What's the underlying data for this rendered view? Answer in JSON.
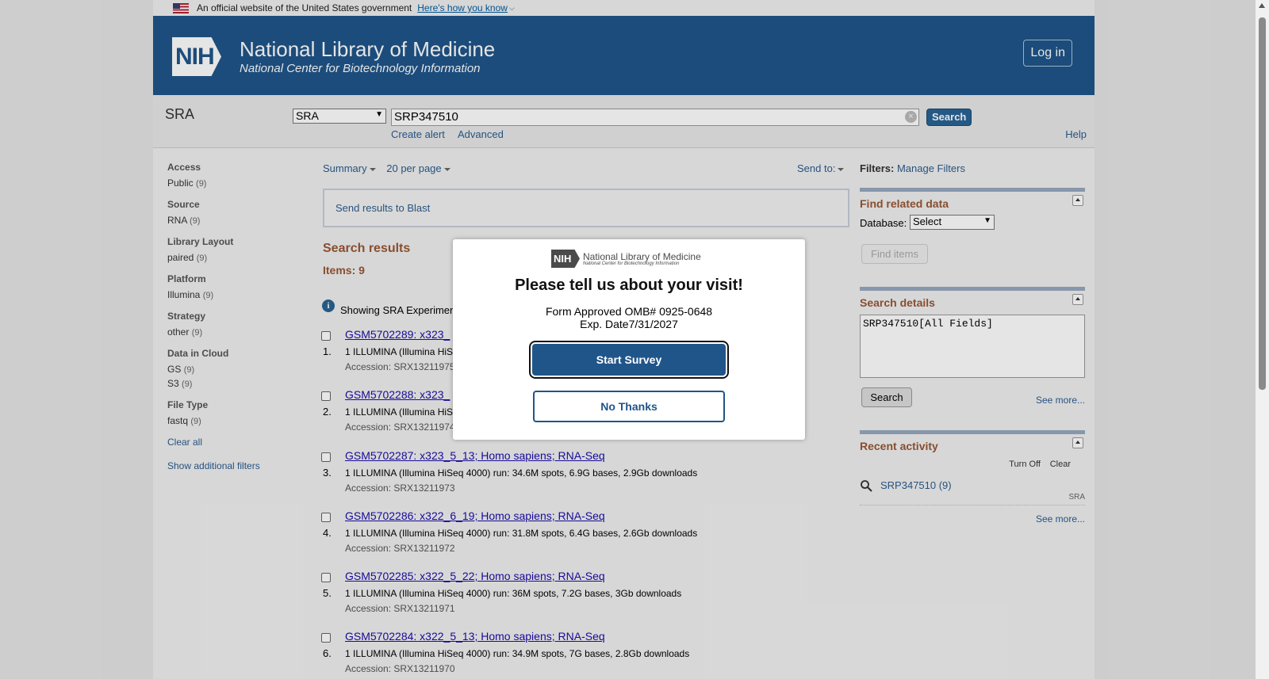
{
  "gov_banner": {
    "text": "An official website of the United States government",
    "link": "Here's how you know"
  },
  "header": {
    "logo_text": "NIH",
    "title": "National Library of Medicine",
    "subtitle": "National Center for Biotechnology Information",
    "login": "Log in"
  },
  "search": {
    "db_name": "SRA",
    "db_select": "SRA",
    "query": "SRP347510",
    "button": "Search",
    "create_alert": "Create alert",
    "advanced": "Advanced",
    "help": "Help"
  },
  "filters": {
    "groups": [
      {
        "title": "Access",
        "items": [
          {
            "label": "Public",
            "count": "(9)"
          }
        ]
      },
      {
        "title": "Source",
        "items": [
          {
            "label": "RNA",
            "count": "(9)"
          }
        ]
      },
      {
        "title": "Library Layout",
        "items": [
          {
            "label": "paired",
            "count": "(9)"
          }
        ]
      },
      {
        "title": "Platform",
        "items": [
          {
            "label": "Illumina",
            "count": "(9)"
          }
        ]
      },
      {
        "title": "Strategy",
        "items": [
          {
            "label": "other",
            "count": "(9)"
          }
        ]
      },
      {
        "title": "Data in Cloud",
        "items": [
          {
            "label": "GS",
            "count": "(9)"
          },
          {
            "label": "S3",
            "count": "(9)"
          }
        ]
      },
      {
        "title": "File Type",
        "items": [
          {
            "label": "fastq",
            "count": "(9)"
          }
        ]
      }
    ],
    "clear_all": "Clear all",
    "show_additional": "Show additional filters"
  },
  "toolbar": {
    "summary": "Summary",
    "per_page": "20 per page",
    "send_to": "Send to:"
  },
  "blast_link": "Send results to Blast",
  "results": {
    "title": "Search results",
    "items": "Items: 9",
    "showing": "Showing SRA Experimen",
    "rows": [
      {
        "num": "1.",
        "title": "GSM5702289: x323_",
        "desc": "1 ILLUMINA (Illumina HiS",
        "acc": "Accession: SRX13211975"
      },
      {
        "num": "2.",
        "title": "GSM5702288: x323_",
        "desc": "1 ILLUMINA (Illumina HiS",
        "acc": "Accession: SRX13211974"
      },
      {
        "num": "3.",
        "title": "GSM5702287: x323_5_13; Homo sapiens; RNA-Seq",
        "desc": "1 ILLUMINA (Illumina HiSeq 4000) run: 34.6M spots, 6.9G bases, 2.9Gb downloads",
        "acc": "Accession: SRX13211973"
      },
      {
        "num": "4.",
        "title": "GSM5702286: x322_6_19; Homo sapiens; RNA-Seq",
        "desc": "1 ILLUMINA (Illumina HiSeq 4000) run: 31.8M spots, 6.4G bases, 2.6Gb downloads",
        "acc": "Accession: SRX13211972"
      },
      {
        "num": "5.",
        "title": "GSM5702285: x322_5_22; Homo sapiens; RNA-Seq",
        "desc": "1 ILLUMINA (Illumina HiSeq 4000) run: 36M spots, 7.2G bases, 3Gb downloads",
        "acc": "Accession: SRX13211971"
      },
      {
        "num": "6.",
        "title": "GSM5702284: x322_5_13; Homo sapiens; RNA-Seq",
        "desc": "1 ILLUMINA (Illumina HiSeq 4000) run: 34.9M spots, 7G bases, 2.8Gb downloads",
        "acc": "Accession: SRX13211970"
      }
    ]
  },
  "right": {
    "filters_label": "Filters:",
    "manage_filters": "Manage Filters",
    "find_related": {
      "title": "Find related data",
      "db_label": "Database:",
      "db_select": "Select",
      "find_btn": "Find items"
    },
    "search_details": {
      "title": "Search details",
      "query": "SRP347510[All Fields]",
      "search_btn": "Search",
      "see_more": "See more..."
    },
    "recent_activity": {
      "title": "Recent activity",
      "turn_off": "Turn Off",
      "clear": "Clear",
      "item": "SRP347510 (9)",
      "item_db": "SRA",
      "see_more": "See more..."
    }
  },
  "modal": {
    "logo_nih": "NIH",
    "logo_title": "National Library of Medicine",
    "logo_sub": "National Center for Biotechnology Information",
    "title": "Please tell us about your visit!",
    "form_line1": "Form Approved OMB# 0925-0648",
    "form_line2": "Exp. Date7/31/2027",
    "start": "Start Survey",
    "no_thanks": "No Thanks"
  }
}
